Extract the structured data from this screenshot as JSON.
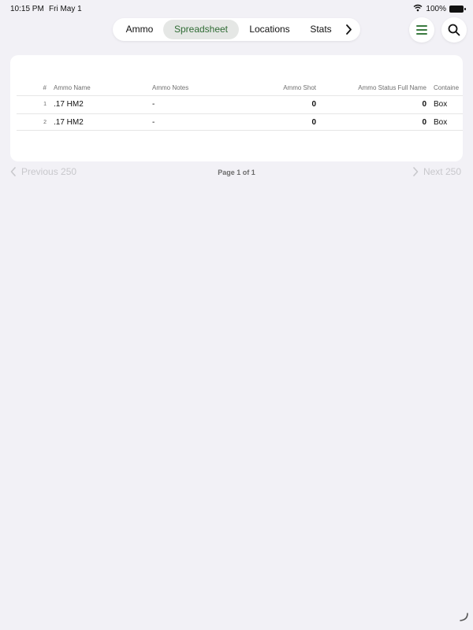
{
  "status_bar": {
    "time": "10:15 PM",
    "date": "Fri May 1",
    "battery": "100%"
  },
  "tabs": [
    {
      "label": "Ammo",
      "active": false
    },
    {
      "label": "Spreadsheet",
      "active": true
    },
    {
      "label": "Locations",
      "active": false
    },
    {
      "label": "Stats",
      "active": false
    }
  ],
  "colors": {
    "accent": "#3a7a3f",
    "background": "#f2f1f6"
  },
  "icons": {
    "more": "chevron-right-icon",
    "menu": "menu-icon",
    "search": "search-icon"
  },
  "table": {
    "columns": [
      "#",
      "Ammo Name",
      "Ammo Notes",
      "Ammo Shot",
      "Ammo Status Full Name",
      "Containe"
    ],
    "rows": [
      [
        "1",
        ".17 HM2",
        "-",
        "0",
        "0",
        "Box"
      ],
      [
        "2",
        ".17 HM2",
        "-",
        "0",
        "0",
        "Box"
      ]
    ]
  },
  "pagination": {
    "previous": "Previous 250",
    "page_info": "Page 1 of 1",
    "next": "Next 250"
  }
}
